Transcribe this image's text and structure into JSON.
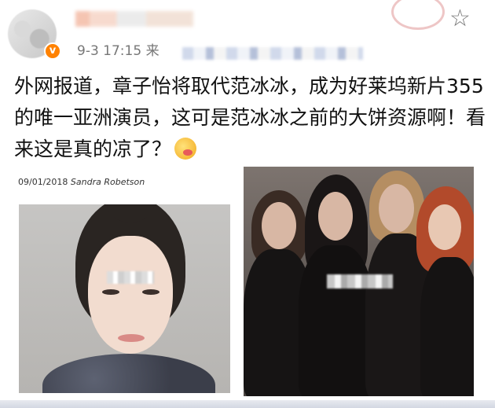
{
  "post": {
    "time": "9-3 17:15",
    "source_prefix": "来",
    "text": "外网报道，章子怡将取代范冰冰，成为好莱坞新片355的唯一亚洲演员，这可是范冰冰之前的大饼资源啊！看来这是真的凉了？"
  },
  "image_left": {
    "date": "09/01/2018",
    "author": "Sandra Robetson"
  },
  "icons": {
    "favorite": "star-outline-icon",
    "verified": "verified-badge-icon",
    "emoji": "yummy-emoji-icon"
  },
  "colors": {
    "verified_badge": "#ff8200",
    "meta_text": "#777777",
    "body_text": "#111111"
  }
}
